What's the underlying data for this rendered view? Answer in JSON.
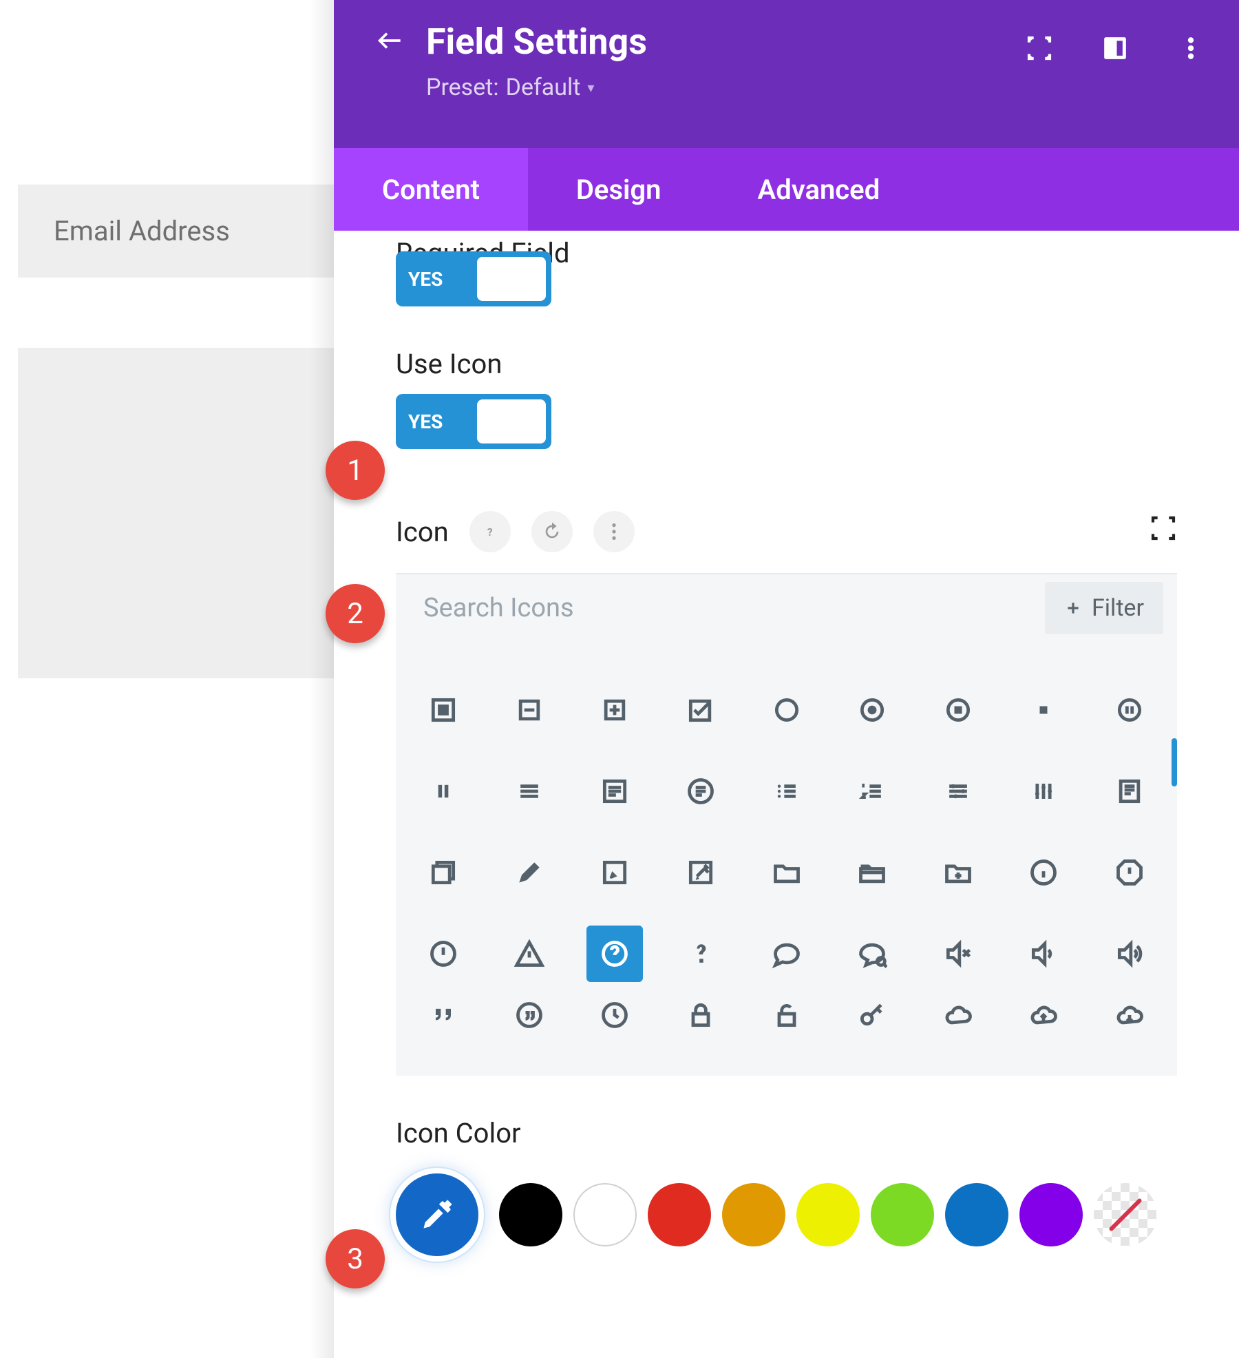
{
  "sidebar": {
    "email_placeholder": "Email Address"
  },
  "header": {
    "title": "Field Settings",
    "preset_prefix": "Preset:",
    "preset_value": "Default"
  },
  "tabs": {
    "content": "Content",
    "design": "Design",
    "advanced": "Advanced"
  },
  "settings": {
    "required_label": "Required Field",
    "required_toggle": "YES",
    "use_icon_label": "Use Icon",
    "use_icon_toggle": "YES",
    "icon_section_label": "Icon",
    "help_glyph": "?",
    "search_placeholder": "Search Icons",
    "filter_label": "Filter",
    "icon_color_label": "Icon Color"
  },
  "icons": {
    "clip_row": [
      "·",
      "·",
      "⌣",
      "·",
      "⌣",
      "↗",
      "↗",
      "·",
      "⎯"
    ],
    "row1": [
      "stop-square-icon",
      "minus-square-icon",
      "plus-square-icon",
      "check-square-icon",
      "circle-icon",
      "dot-circle-icon",
      "stop-circle-icon",
      "small-square-icon",
      "pause-circle-icon"
    ],
    "row2": [
      "pause-icon",
      "lines-icon",
      "list-box-icon",
      "list-circle-icon",
      "bullet-list-icon",
      "numbered-list-icon",
      "sliders-icon",
      "equalizer-icon",
      "article-icon"
    ],
    "row3": [
      "stack-icon",
      "pencil-icon",
      "edit-square-icon",
      "edit-note-icon",
      "folder-icon",
      "folder-open-icon",
      "folder-plus-icon",
      "info-circle-icon",
      "alert-octagon-icon"
    ],
    "row4": [
      "alert-circle-icon",
      "warning-triangle-icon",
      "question-circle-icon",
      "question-mark-icon",
      "chat-icon",
      "chat-search-icon",
      "volume-mute-icon",
      "volume-low-icon",
      "volume-high-icon"
    ],
    "row5": [
      "quote-close-icon",
      "quote-circle-icon",
      "clock-icon",
      "lock-icon",
      "unlock-icon",
      "key-icon",
      "cloud-icon",
      "cloud-up-icon",
      "cloud-down-icon"
    ]
  },
  "colors": [
    "black",
    "white",
    "red",
    "orange",
    "yellow",
    "green",
    "blue",
    "purple",
    "transparent"
  ],
  "annotations": {
    "1": "1",
    "2": "2",
    "3": "3"
  }
}
